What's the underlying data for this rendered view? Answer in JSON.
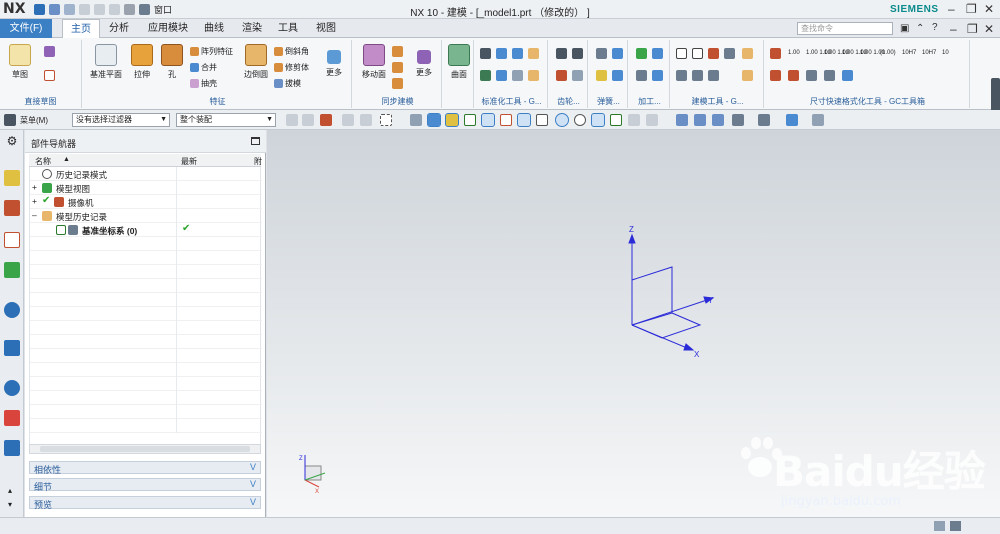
{
  "app": {
    "logo": "NX",
    "window_title": "NX 10 - 建模 - [_model1.prt （修改的） ]",
    "brand": "SIEMENS",
    "window_menu": "窗口"
  },
  "tabs": [
    {
      "label": "文件(F)"
    },
    {
      "label": "主页"
    },
    {
      "label": "分析"
    },
    {
      "label": "应用模块"
    },
    {
      "label": "曲线"
    },
    {
      "label": "渲染"
    },
    {
      "label": "工具"
    },
    {
      "label": "视图"
    }
  ],
  "search": {
    "placeholder": "查找命令"
  },
  "ribbon": {
    "groups": {
      "sketch": "直接草图",
      "feature": "特征",
      "sync": "同步建模",
      "std": "标准化工具 - G...",
      "gear": "齿轮...",
      "spring": "弹簧...",
      "machining": "加工...",
      "build": "建模工具 - G...",
      "dim": "尺寸快速格式化工具 - GC工具箱"
    },
    "buttons": {
      "sketch": "草图",
      "datum_plane": "基准平面",
      "extrude": "拉伸",
      "hole": "孔",
      "pattern": "阵列特征",
      "unite": "合并",
      "shell": "抽壳",
      "edge_blend": "边倒圆",
      "chamfer": "倒斜角",
      "trim_body": "修剪体",
      "draft": "拔模",
      "more1": "更多",
      "move_face": "移动面",
      "more2": "更多",
      "surface": "曲面"
    },
    "dim_labels": [
      "1.00",
      "1.00\n1.00",
      "1.00\n1.00",
      "1.00\n1.00",
      "1.00\n1.00",
      "(1.00)",
      "10H7",
      "10H7",
      "10"
    ]
  },
  "cmdbar": {
    "menu": "菜单(M)",
    "filter": "没有选择过滤器",
    "assembly": "整个装配"
  },
  "navigator": {
    "title": "部件导航器",
    "col_name": "名称",
    "col_latest": "最新",
    "col_third": "附",
    "rows": [
      {
        "label": "历史记录模式"
      },
      {
        "label": "模型视图"
      },
      {
        "label": "摄像机"
      },
      {
        "label": "模型历史记录"
      },
      {
        "label": "基准坐标系 (0)"
      }
    ],
    "panels": [
      "相依性",
      "细节",
      "预览"
    ]
  },
  "axes": {
    "z": "Z",
    "y": "Y",
    "x": "X"
  },
  "watermark": {
    "main": "Baidu经验",
    "sub": "jingyan.baidu.com"
  },
  "colors": {
    "file_tab": "#3b7fc4",
    "axis": "#2b2bd8",
    "brand": "#0a8a8a",
    "check": "#2aa52a"
  }
}
